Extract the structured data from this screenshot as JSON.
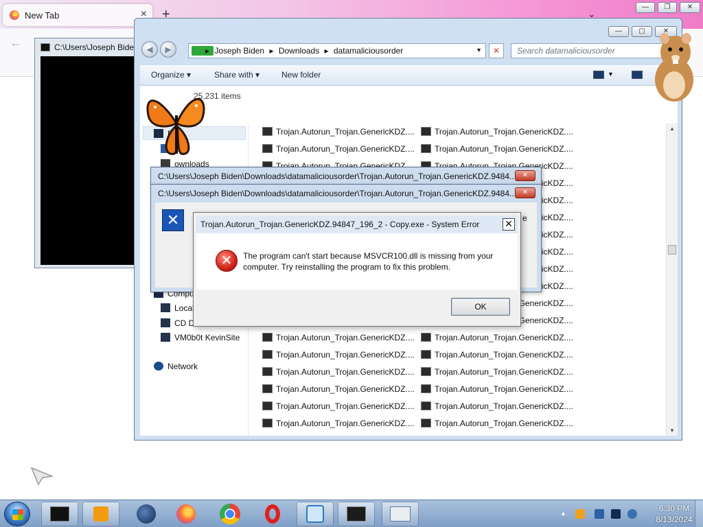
{
  "browser": {
    "tab_title": "New Tab",
    "tab_close": "×",
    "new_tab": "+",
    "list_all_tabs": "⌄",
    "back": "←",
    "window_buttons": {
      "minimize": "—",
      "maximize": "❐",
      "close": "✕"
    }
  },
  "cmd": {
    "title": "C:\\Users\\Joseph Biden"
  },
  "explorer": {
    "window_buttons": {
      "minimize": "—",
      "maximize": "▢",
      "close": "✕"
    },
    "nav": {
      "back": "◀",
      "forward": "▶"
    },
    "address": {
      "crumbs": [
        "Joseph Biden",
        "Downloads",
        "datamaliciousorder"
      ],
      "separator": "▸",
      "dropdown": "▼",
      "clear": "✕"
    },
    "search_placeholder": "Search datamaliciousorder",
    "toolbar": {
      "organize": "Organize ▾",
      "share_with": "Share with ▾",
      "new_folder": "New folder"
    },
    "items_count": "25,231 items",
    "nav_pane": [
      {
        "label": "F",
        "icon": "favorites-icon"
      },
      {
        "label": "ktop",
        "icon": "desktop-icon"
      },
      {
        "label": "ownloads",
        "icon": "downloads-icon"
      },
      {
        "label": "Compu",
        "icon": "computer-icon"
      },
      {
        "label": "Local",
        "icon": "local-disk-icon"
      },
      {
        "label": "CD D",
        "icon": "cd-drive-icon"
      },
      {
        "label": "VM0b0t KevinSite",
        "icon": "network-drive-icon"
      },
      {
        "label": "Network",
        "icon": "network-icon"
      }
    ],
    "file_name": "Trojan.Autorun_Trojan.GenericKDZ....",
    "visible_rows_col1": 18,
    "visible_rows_col2": 18
  },
  "error_windows": [
    {
      "title": "C:\\Users\\Joseph Biden\\Downloads\\datamaliciousorder\\Trojan.Autorun_Trojan.GenericKDZ.9484..."
    },
    {
      "title": "C:\\Users\\Joseph Biden\\Downloads\\datamaliciousorder\\Trojan.Autorun_Trojan.GenericKDZ.9484...",
      "partial_text": "e"
    }
  ],
  "system_error": {
    "title": "Trojan.Autorun_Trojan.GenericKDZ.94847_196_2 - Copy.exe - System Error",
    "close": "✕",
    "message": "The program can't start because MSVCR100.dll is missing from your computer. Try reinstalling the program to fix this problem.",
    "ok": "OK"
  },
  "taskbar": {
    "pinned": [
      {
        "name": "cmd-taskbar-button"
      },
      {
        "name": "media-player-taskbar-button"
      },
      {
        "name": "tor-taskbar-button"
      },
      {
        "name": "firefox-taskbar-button"
      },
      {
        "name": "chrome-taskbar-button"
      },
      {
        "name": "opera-taskbar-button"
      },
      {
        "name": "search-taskbar-button"
      },
      {
        "name": "terminal-taskbar-button"
      },
      {
        "name": "explorer-taskbar-button"
      }
    ],
    "tray_expand": "▲",
    "time": "6:30 PM",
    "date": "8/13/2024"
  },
  "colors": {
    "accent": "#3a78c8",
    "error_red": "#d0231b",
    "taskbar": "#8fabd0"
  }
}
